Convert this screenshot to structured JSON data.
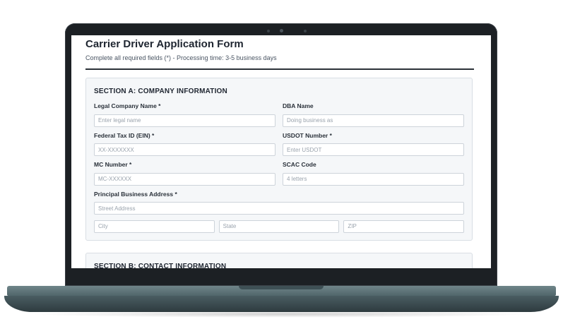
{
  "form": {
    "title": "Carrier Driver Application Form",
    "subtitle": "Complete all required fields (*) - Processing time: 3-5 business days"
  },
  "section_a": {
    "title": "SECTION A: COMPANY INFORMATION",
    "legal_name": {
      "label": "Legal Company Name *",
      "placeholder": "Enter legal name"
    },
    "dba_name": {
      "label": "DBA Name",
      "placeholder": "Doing business as"
    },
    "ein": {
      "label": "Federal Tax ID (EIN) *",
      "placeholder": "XX-XXXXXXX"
    },
    "usdot": {
      "label": "USDOT Number *",
      "placeholder": "Enter USDOT"
    },
    "mc_number": {
      "label": "MC Number *",
      "placeholder": "MC-XXXXXX"
    },
    "scac": {
      "label": "SCAC Code",
      "placeholder": "4 letters"
    },
    "address": {
      "label": "Principal Business Address *",
      "street_placeholder": "Street Address",
      "city_placeholder": "City",
      "state_placeholder": "State",
      "zip_placeholder": "ZIP"
    }
  },
  "section_b": {
    "title": "SECTION B: CONTACT INFORMATION"
  },
  "colors": {
    "bezel": "#1c2024",
    "base": "#5a6f74",
    "section_bg": "#f5f7f9",
    "text": "#1e2530"
  }
}
